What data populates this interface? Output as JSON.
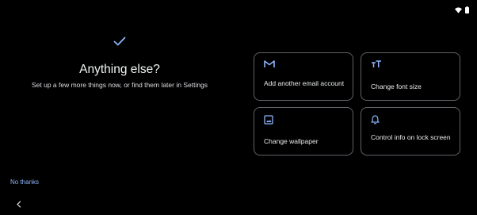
{
  "screen": {
    "title": "Anything else?",
    "subtitle": "Set up a few more things now, or find them later in Settings",
    "no_thanks_label": "No thanks"
  },
  "options": [
    {
      "label": "Add another email account",
      "icon": "gmail-icon"
    },
    {
      "label": "Change font size",
      "icon": "font-size-icon"
    },
    {
      "label": "Change wallpaper",
      "icon": "wallpaper-icon"
    },
    {
      "label": "Control info on lock screen",
      "icon": "bell-icon"
    }
  ],
  "colors": {
    "accent": "#8ab4f8",
    "background": "#000000",
    "card_border": "#5f6368",
    "text": "#e8eaed"
  },
  "icons": {
    "status": [
      "wifi-icon",
      "battery-icon"
    ],
    "back": "back-arrow-icon",
    "check": "checkmark-icon"
  }
}
